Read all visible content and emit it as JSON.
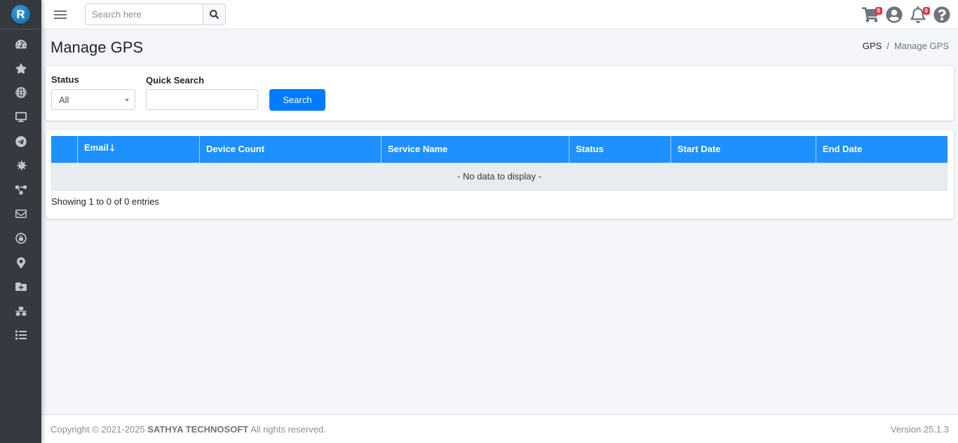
{
  "app": {
    "logo_letter": "R",
    "brand_color": "#1f7cb4"
  },
  "sidebar": {
    "items": [
      {
        "icon": "dashboard-icon"
      },
      {
        "icon": "star-icon"
      },
      {
        "icon": "globe-icon"
      },
      {
        "icon": "desktop-icon"
      },
      {
        "icon": "telegram-icon"
      },
      {
        "icon": "virus-icon"
      },
      {
        "icon": "project-diagram-icon"
      },
      {
        "icon": "envelope-icon"
      },
      {
        "icon": "lock-icon"
      },
      {
        "icon": "map-marker-icon"
      },
      {
        "icon": "folder-plus-icon"
      },
      {
        "icon": "network-icon"
      },
      {
        "icon": "list-icon"
      }
    ]
  },
  "topbar": {
    "search_placeholder": "Search here",
    "search_value": "",
    "cart_count": "0",
    "notification_count": "0"
  },
  "page": {
    "title": "Manage GPS",
    "breadcrumb": {
      "parent": "GPS",
      "separator": "/",
      "current": "Manage GPS"
    }
  },
  "filters": {
    "status_label": "Status",
    "status_value": "All",
    "quick_search_label": "Quick Search",
    "quick_search_value": "",
    "search_button": "Search"
  },
  "table": {
    "columns": [
      "",
      "Email",
      "Device Count",
      "Service Name",
      "Status",
      "Start Date",
      "End Date"
    ],
    "sort_column": "Email",
    "sort_direction": "descending",
    "sort_arrow": "🡓",
    "empty_message": "- No data to display -",
    "rows": [],
    "info": "Showing 1 to 0 of 0 entries"
  },
  "footer": {
    "copyright_prefix": "Copyright © 2021-2025 ",
    "company": "SATHYA TECHNOSOFT",
    "copyright_suffix": " All rights reserved.",
    "version": "Version 25.1.3"
  },
  "colors": {
    "primary": "#007bff",
    "table_header": "#1e90ff",
    "sidebar_bg": "#343a40",
    "badge": "#dc3545"
  }
}
